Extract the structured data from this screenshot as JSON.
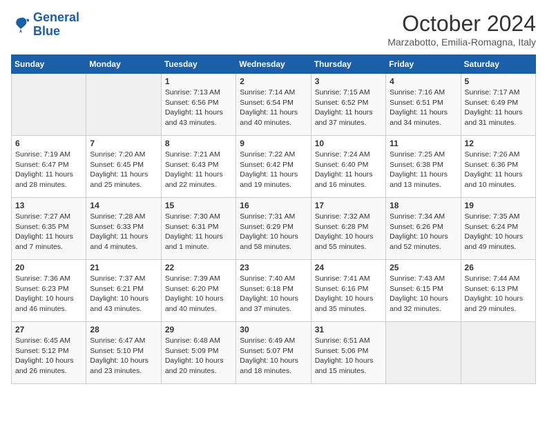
{
  "header": {
    "logo_line1": "General",
    "logo_line2": "Blue",
    "month_year": "October 2024",
    "location": "Marzabotto, Emilia-Romagna, Italy"
  },
  "days_of_week": [
    "Sunday",
    "Monday",
    "Tuesday",
    "Wednesday",
    "Thursday",
    "Friday",
    "Saturday"
  ],
  "weeks": [
    [
      {
        "day": "",
        "sunrise": "",
        "sunset": "",
        "daylight": ""
      },
      {
        "day": "",
        "sunrise": "",
        "sunset": "",
        "daylight": ""
      },
      {
        "day": "1",
        "sunrise": "Sunrise: 7:13 AM",
        "sunset": "Sunset: 6:56 PM",
        "daylight": "Daylight: 11 hours and 43 minutes."
      },
      {
        "day": "2",
        "sunrise": "Sunrise: 7:14 AM",
        "sunset": "Sunset: 6:54 PM",
        "daylight": "Daylight: 11 hours and 40 minutes."
      },
      {
        "day": "3",
        "sunrise": "Sunrise: 7:15 AM",
        "sunset": "Sunset: 6:52 PM",
        "daylight": "Daylight: 11 hours and 37 minutes."
      },
      {
        "day": "4",
        "sunrise": "Sunrise: 7:16 AM",
        "sunset": "Sunset: 6:51 PM",
        "daylight": "Daylight: 11 hours and 34 minutes."
      },
      {
        "day": "5",
        "sunrise": "Sunrise: 7:17 AM",
        "sunset": "Sunset: 6:49 PM",
        "daylight": "Daylight: 11 hours and 31 minutes."
      }
    ],
    [
      {
        "day": "6",
        "sunrise": "Sunrise: 7:19 AM",
        "sunset": "Sunset: 6:47 PM",
        "daylight": "Daylight: 11 hours and 28 minutes."
      },
      {
        "day": "7",
        "sunrise": "Sunrise: 7:20 AM",
        "sunset": "Sunset: 6:45 PM",
        "daylight": "Daylight: 11 hours and 25 minutes."
      },
      {
        "day": "8",
        "sunrise": "Sunrise: 7:21 AM",
        "sunset": "Sunset: 6:43 PM",
        "daylight": "Daylight: 11 hours and 22 minutes."
      },
      {
        "day": "9",
        "sunrise": "Sunrise: 7:22 AM",
        "sunset": "Sunset: 6:42 PM",
        "daylight": "Daylight: 11 hours and 19 minutes."
      },
      {
        "day": "10",
        "sunrise": "Sunrise: 7:24 AM",
        "sunset": "Sunset: 6:40 PM",
        "daylight": "Daylight: 11 hours and 16 minutes."
      },
      {
        "day": "11",
        "sunrise": "Sunrise: 7:25 AM",
        "sunset": "Sunset: 6:38 PM",
        "daylight": "Daylight: 11 hours and 13 minutes."
      },
      {
        "day": "12",
        "sunrise": "Sunrise: 7:26 AM",
        "sunset": "Sunset: 6:36 PM",
        "daylight": "Daylight: 11 hours and 10 minutes."
      }
    ],
    [
      {
        "day": "13",
        "sunrise": "Sunrise: 7:27 AM",
        "sunset": "Sunset: 6:35 PM",
        "daylight": "Daylight: 11 hours and 7 minutes."
      },
      {
        "day": "14",
        "sunrise": "Sunrise: 7:28 AM",
        "sunset": "Sunset: 6:33 PM",
        "daylight": "Daylight: 11 hours and 4 minutes."
      },
      {
        "day": "15",
        "sunrise": "Sunrise: 7:30 AM",
        "sunset": "Sunset: 6:31 PM",
        "daylight": "Daylight: 11 hours and 1 minute."
      },
      {
        "day": "16",
        "sunrise": "Sunrise: 7:31 AM",
        "sunset": "Sunset: 6:29 PM",
        "daylight": "Daylight: 10 hours and 58 minutes."
      },
      {
        "day": "17",
        "sunrise": "Sunrise: 7:32 AM",
        "sunset": "Sunset: 6:28 PM",
        "daylight": "Daylight: 10 hours and 55 minutes."
      },
      {
        "day": "18",
        "sunrise": "Sunrise: 7:34 AM",
        "sunset": "Sunset: 6:26 PM",
        "daylight": "Daylight: 10 hours and 52 minutes."
      },
      {
        "day": "19",
        "sunrise": "Sunrise: 7:35 AM",
        "sunset": "Sunset: 6:24 PM",
        "daylight": "Daylight: 10 hours and 49 minutes."
      }
    ],
    [
      {
        "day": "20",
        "sunrise": "Sunrise: 7:36 AM",
        "sunset": "Sunset: 6:23 PM",
        "daylight": "Daylight: 10 hours and 46 minutes."
      },
      {
        "day": "21",
        "sunrise": "Sunrise: 7:37 AM",
        "sunset": "Sunset: 6:21 PM",
        "daylight": "Daylight: 10 hours and 43 minutes."
      },
      {
        "day": "22",
        "sunrise": "Sunrise: 7:39 AM",
        "sunset": "Sunset: 6:20 PM",
        "daylight": "Daylight: 10 hours and 40 minutes."
      },
      {
        "day": "23",
        "sunrise": "Sunrise: 7:40 AM",
        "sunset": "Sunset: 6:18 PM",
        "daylight": "Daylight: 10 hours and 37 minutes."
      },
      {
        "day": "24",
        "sunrise": "Sunrise: 7:41 AM",
        "sunset": "Sunset: 6:16 PM",
        "daylight": "Daylight: 10 hours and 35 minutes."
      },
      {
        "day": "25",
        "sunrise": "Sunrise: 7:43 AM",
        "sunset": "Sunset: 6:15 PM",
        "daylight": "Daylight: 10 hours and 32 minutes."
      },
      {
        "day": "26",
        "sunrise": "Sunrise: 7:44 AM",
        "sunset": "Sunset: 6:13 PM",
        "daylight": "Daylight: 10 hours and 29 minutes."
      }
    ],
    [
      {
        "day": "27",
        "sunrise": "Sunrise: 6:45 AM",
        "sunset": "Sunset: 5:12 PM",
        "daylight": "Daylight: 10 hours and 26 minutes."
      },
      {
        "day": "28",
        "sunrise": "Sunrise: 6:47 AM",
        "sunset": "Sunset: 5:10 PM",
        "daylight": "Daylight: 10 hours and 23 minutes."
      },
      {
        "day": "29",
        "sunrise": "Sunrise: 6:48 AM",
        "sunset": "Sunset: 5:09 PM",
        "daylight": "Daylight: 10 hours and 20 minutes."
      },
      {
        "day": "30",
        "sunrise": "Sunrise: 6:49 AM",
        "sunset": "Sunset: 5:07 PM",
        "daylight": "Daylight: 10 hours and 18 minutes."
      },
      {
        "day": "31",
        "sunrise": "Sunrise: 6:51 AM",
        "sunset": "Sunset: 5:06 PM",
        "daylight": "Daylight: 10 hours and 15 minutes."
      },
      {
        "day": "",
        "sunrise": "",
        "sunset": "",
        "daylight": ""
      },
      {
        "day": "",
        "sunrise": "",
        "sunset": "",
        "daylight": ""
      }
    ]
  ]
}
